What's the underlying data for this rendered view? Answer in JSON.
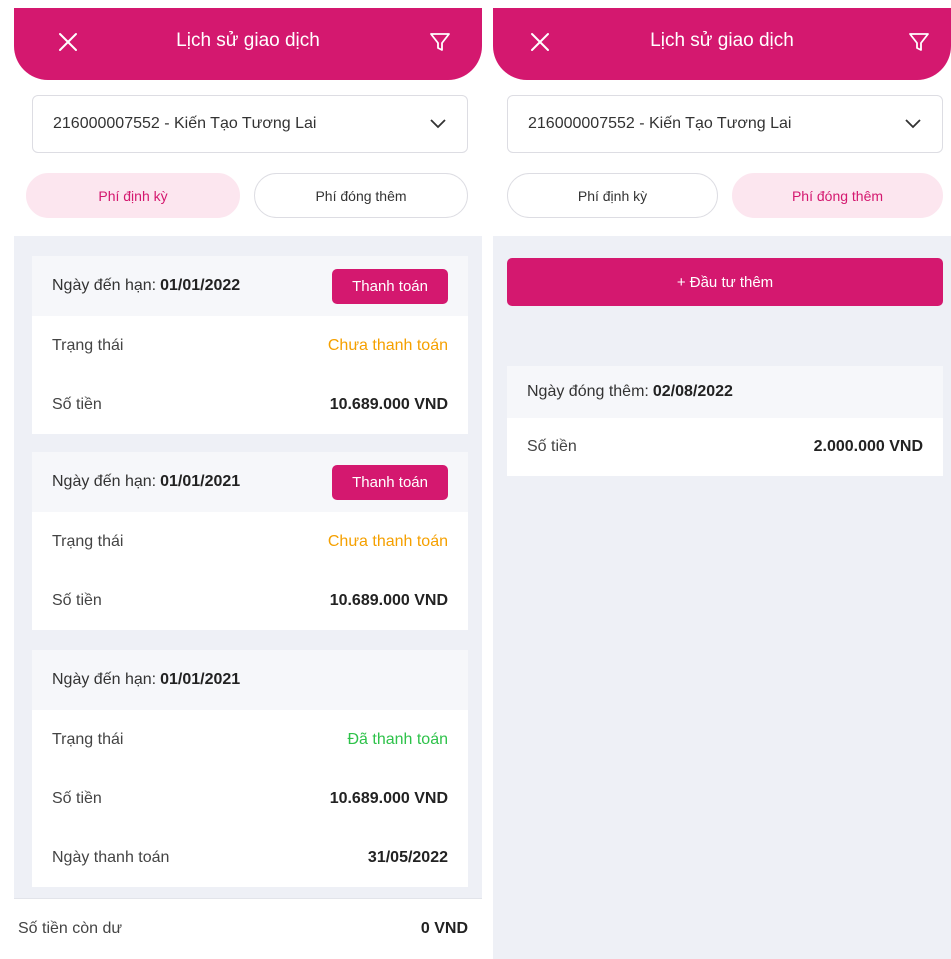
{
  "left": {
    "header": {
      "title": "Lịch sử giao dịch"
    },
    "account": {
      "value": "216000007552 - Kiến Tạo Tương Lai"
    },
    "tabs": [
      {
        "label": "Phí định kỳ"
      },
      {
        "label": "Phí đóng thêm"
      }
    ],
    "cards": [
      {
        "due_label": "Ngày đến hạn:",
        "due_date": "01/01/2022",
        "pay_label": "Thanh toán",
        "status_label": "Trạng thái",
        "status_value": "Chưa thanh toán",
        "amount_label": "Số tiền",
        "amount_value": "10.689.000 VND"
      },
      {
        "due_label": "Ngày đến hạn:",
        "due_date": "01/01/2021",
        "pay_label": "Thanh toán",
        "status_label": "Trạng thái",
        "status_value": "Chưa thanh toán",
        "amount_label": "Số tiền",
        "amount_value": "10.689.000 VND"
      },
      {
        "due_label": "Ngày đến hạn:",
        "due_date": "01/01/2021",
        "status_label": "Trạng thái",
        "status_value": "Đã thanh toán",
        "amount_label": "Số tiền",
        "amount_value": "10.689.000 VND",
        "paydate_label": "Ngày thanh toán",
        "paydate_value": "31/05/2022"
      }
    ],
    "footer": {
      "label": "Số tiền còn dư",
      "value": "0 VND"
    }
  },
  "right": {
    "header": {
      "title": "Lịch sử giao dịch"
    },
    "account": {
      "value": "216000007552 - Kiến Tạo Tương Lai"
    },
    "tabs": [
      {
        "label": "Phí định kỳ"
      },
      {
        "label": "Phí đóng thêm"
      }
    ],
    "invest_button": "+ Đầu tư thêm",
    "extra": {
      "date_label": "Ngày đóng thêm:",
      "date_value": "02/08/2022",
      "amount_label": "Số tiền",
      "amount_value": "2.000.000 VND"
    }
  },
  "colors": {
    "brand": "#d4186f",
    "unpaid": "#f5a000",
    "paid": "#2ec24a",
    "background": "#eef0f6"
  },
  "icons": {
    "close": "close-icon",
    "filter": "filter-icon",
    "dropdown": "chevron-down-icon"
  }
}
